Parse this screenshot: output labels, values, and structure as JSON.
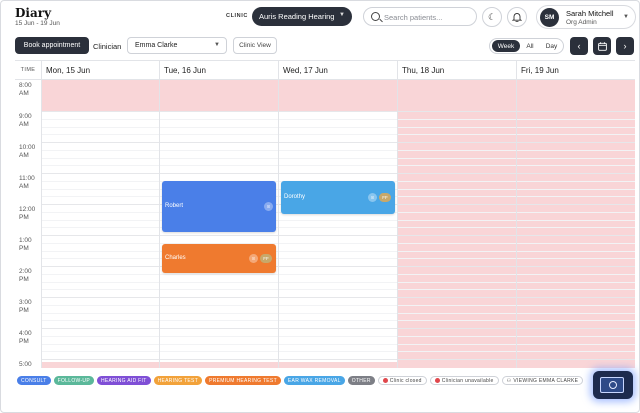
{
  "header": {
    "title": "Diary",
    "date_range": "15 Jun - 19 Jun",
    "clinic_label": "CLINIC",
    "clinic_selected": "Auris Reading Hearing",
    "search_placeholder": "Search patients...",
    "user_initials": "SM",
    "user_name": "Sarah Mitchell",
    "user_role": "Org Admin"
  },
  "toolbar": {
    "book_label": "Book appointment",
    "clinician_label": "Clinician",
    "clinician_selected": "Emma Clarke",
    "clinic_view_label": "Clinic View",
    "views": [
      "Week",
      "All",
      "Day"
    ],
    "active_view": "Week"
  },
  "calendar": {
    "time_header": "TIME",
    "days": [
      "Mon, 15 Jun",
      "Tue, 16 Jun",
      "Wed, 17 Jun",
      "Thu, 18 Jun",
      "Fri, 19 Jun"
    ],
    "time_labels": [
      {
        "h": "8:00",
        "p": "AM"
      },
      {
        "h": "9:00",
        "p": "AM"
      },
      {
        "h": "10:00",
        "p": "AM"
      },
      {
        "h": "11:00",
        "p": "AM"
      },
      {
        "h": "12:00",
        "p": "PM"
      },
      {
        "h": "1:00",
        "p": "PM"
      },
      {
        "h": "2:00",
        "p": "PM"
      },
      {
        "h": "3:00",
        "p": "PM"
      },
      {
        "h": "4:00",
        "p": "PM"
      },
      {
        "h": "5:00",
        "p": ""
      }
    ],
    "appointments": [
      {
        "name": "Robert",
        "badge": "8",
        "badge2": "",
        "color": "#4a7fe8"
      },
      {
        "name": "Dorothy",
        "badge": "8",
        "badge2": "FF",
        "color": "#49a6e6"
      },
      {
        "name": "Charles",
        "badge": "8",
        "badge2": "FF",
        "color": "#ef7a2f"
      }
    ]
  },
  "legend": {
    "items": [
      {
        "label": "CONSULT",
        "color": "#4a7fe8"
      },
      {
        "label": "FOLLOW-UP",
        "color": "#5bb89a"
      },
      {
        "label": "HEARING AID FIT",
        "color": "#7f4fd6"
      },
      {
        "label": "HEARING TEST",
        "color": "#f2a23a"
      },
      {
        "label": "PREMIUM HEARING TEST",
        "color": "#ef7a2f"
      },
      {
        "label": "EAR WAX REMOVAL",
        "color": "#49a6e6"
      },
      {
        "label": "OTHER",
        "color": "#7d7f86"
      }
    ],
    "clinic_closed": "Clinic closed",
    "clinician_unavailable": "Clinician unavailable",
    "viewing": "VIEWING EMMA CLARKE"
  }
}
